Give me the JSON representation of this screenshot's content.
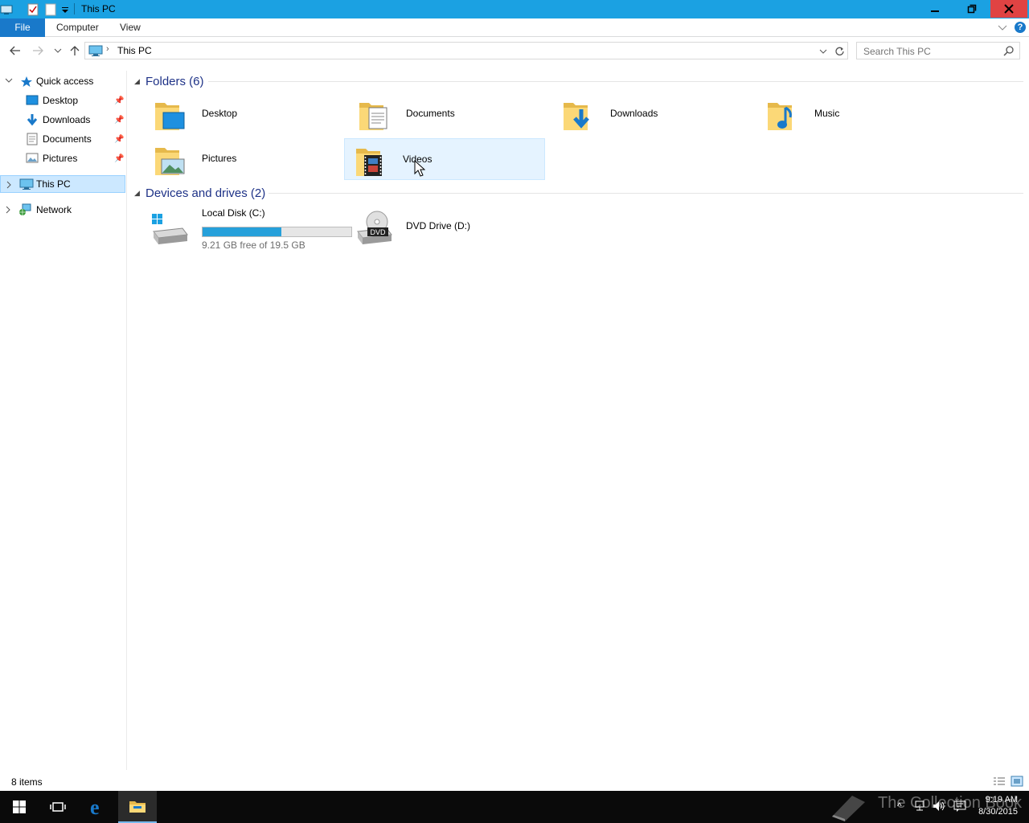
{
  "window": {
    "title": "This PC"
  },
  "ribbon": {
    "tabs": [
      {
        "label": "File"
      },
      {
        "label": "Computer"
      },
      {
        "label": "View"
      }
    ]
  },
  "address": {
    "path": "This PC"
  },
  "search": {
    "placeholder": "Search This PC"
  },
  "navpane": {
    "quick_access": "Quick access",
    "items": [
      {
        "label": "Desktop",
        "pinned": true
      },
      {
        "label": "Downloads",
        "pinned": true
      },
      {
        "label": "Documents",
        "pinned": true
      },
      {
        "label": "Pictures",
        "pinned": true
      }
    ],
    "this_pc": "This PC",
    "network": "Network"
  },
  "content": {
    "folders_header": "Folders (6)",
    "folders": [
      {
        "name": "Desktop",
        "icon": "desktop-folder-icon"
      },
      {
        "name": "Documents",
        "icon": "documents-folder-icon"
      },
      {
        "name": "Downloads",
        "icon": "downloads-folder-icon"
      },
      {
        "name": "Music",
        "icon": "music-folder-icon"
      },
      {
        "name": "Pictures",
        "icon": "pictures-folder-icon"
      },
      {
        "name": "Videos",
        "icon": "videos-folder-icon",
        "selected": true
      }
    ],
    "devices_header": "Devices and drives (2)",
    "drives": [
      {
        "name": "Local Disk (C:)",
        "free_text": "9.21 GB free of 19.5 GB",
        "used_fraction": 0.53
      },
      {
        "name": "DVD Drive (D:)",
        "icon_label": "DVD"
      }
    ]
  },
  "status": {
    "items": "8 items"
  },
  "taskbar": {
    "time": "9:19 AM",
    "date": "8/30/2015",
    "watermark": "The Collection Book"
  },
  "colors": {
    "accent": "#1ba1e2",
    "file_tab": "#1979ca",
    "selection": "#cce8ff",
    "disk_bar": "#26a0da"
  }
}
